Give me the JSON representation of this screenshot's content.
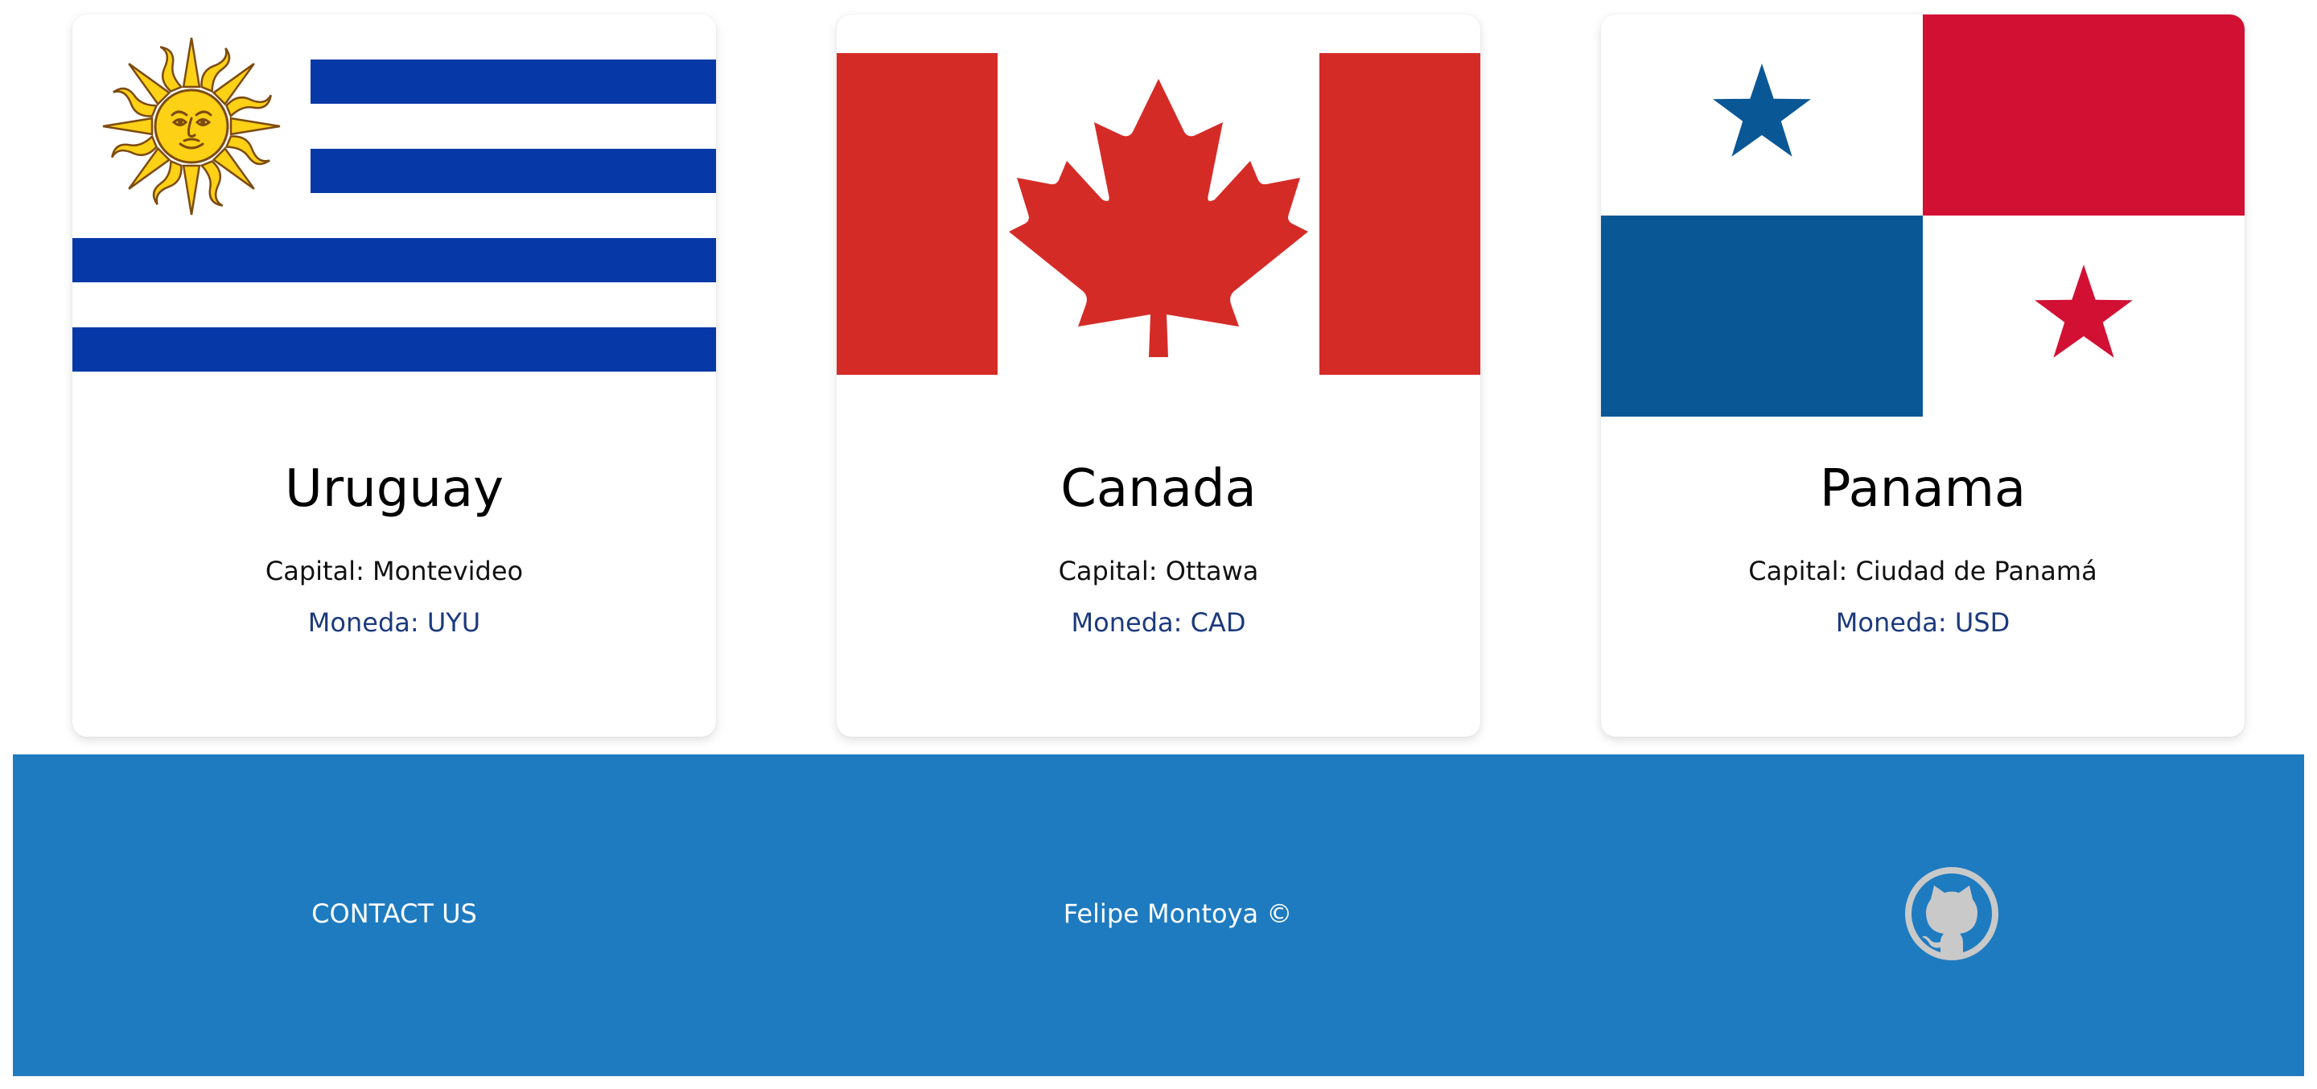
{
  "cards": [
    {
      "name": "Uruguay",
      "capital": "Capital: Montevideo",
      "currency": "Moneda: UYU",
      "flag_icon": "flag-uruguay-icon"
    },
    {
      "name": "Canada",
      "capital": "Capital: Ottawa",
      "currency": "Moneda: CAD",
      "flag_icon": "flag-canada-icon"
    },
    {
      "name": "Panama",
      "capital": "Capital: Ciudad de Panamá",
      "currency": "Moneda: USD",
      "flag_icon": "flag-panama-icon"
    }
  ],
  "footer": {
    "contact_label": "CONTACT US",
    "copyright": "Felipe Montoya ©",
    "social_icon": "github-icon"
  },
  "colors": {
    "footer_bg": "#1e7bc0",
    "currency_text": "#1c3a7c",
    "uruguay_blue": "#0638a7",
    "uruguay_sun": "#fcd116",
    "canada_red": "#d52b27",
    "panama_red": "#d21034",
    "panama_blue": "#0a5795"
  }
}
